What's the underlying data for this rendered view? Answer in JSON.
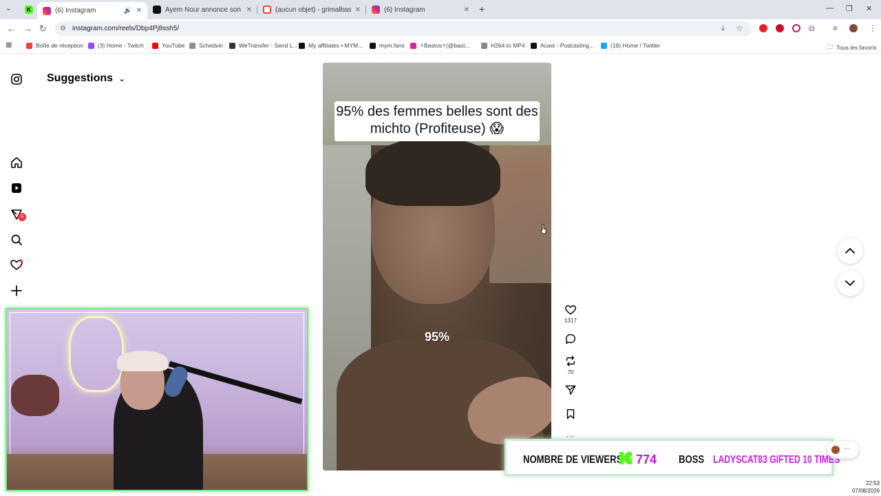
{
  "browser": {
    "tabs": [
      {
        "title": "",
        "favicon": "kick-icon",
        "color": "#53fc18",
        "active": false
      },
      {
        "title": "(6) Instagram",
        "favicon": "instagram-icon",
        "color": "#d6249f",
        "active": true
      },
      {
        "title": "Ayem Nour annonce son arrivé...",
        "favicon": "tiktok-icon",
        "color": "#111111",
        "active": false
      },
      {
        "title": "(aucun objet) - grimalbastien@...",
        "favicon": "gmail-icon",
        "color": "#ea4335",
        "active": false
      },
      {
        "title": "(6) Instagram",
        "favicon": "instagram-icon",
        "color": "#d6249f",
        "active": false
      }
    ],
    "url": "instagram.com/reels/Dbp4Pj8ssh5/",
    "bookmarks": [
      {
        "label": "Boîte de réception",
        "color": "#ea4335"
      },
      {
        "label": "(3) Home - Twitch",
        "color": "#9146ff"
      },
      {
        "label": "YouTube",
        "color": "#ff0000"
      },
      {
        "label": "Schedvin",
        "color": "#8e8e8e"
      },
      {
        "label": "WeTransfer - Send L...",
        "color": "#333333"
      },
      {
        "label": "My affiliates • MYM...",
        "color": "#111111"
      },
      {
        "label": "mym.fans",
        "color": "#111111"
      },
      {
        "label": "⚡Bastos⚡(@bast...",
        "color": "#d6249f"
      },
      {
        "label": "H264 to MP4",
        "color": "#888888"
      },
      {
        "label": "Acast - Podcasting...",
        "color": "#111111"
      },
      {
        "label": "(19) Home / Twitter",
        "color": "#1da1f2"
      }
    ],
    "all_bookmarks": "Tous les favoris"
  },
  "instagram": {
    "header": "Suggestions",
    "notification_count": "6",
    "reel": {
      "caption": "95% des femmes belles sont des michto (Profiteuse) 😱",
      "overlay_text": "95%"
    },
    "actions": {
      "likes": "1317",
      "reposts": "70"
    }
  },
  "stream_overlay": {
    "viewers_label": "NOMBRE DE VIEWERS",
    "viewers_count": "774",
    "boss_label": "BOSS",
    "gift_text": "LADYSCAT83 GIFTED 10 TIMES",
    "accent": "#53fc18",
    "highlight": "#c31fe0"
  },
  "taskbar": {
    "time": "22:53",
    "date": "07/08/2026"
  }
}
